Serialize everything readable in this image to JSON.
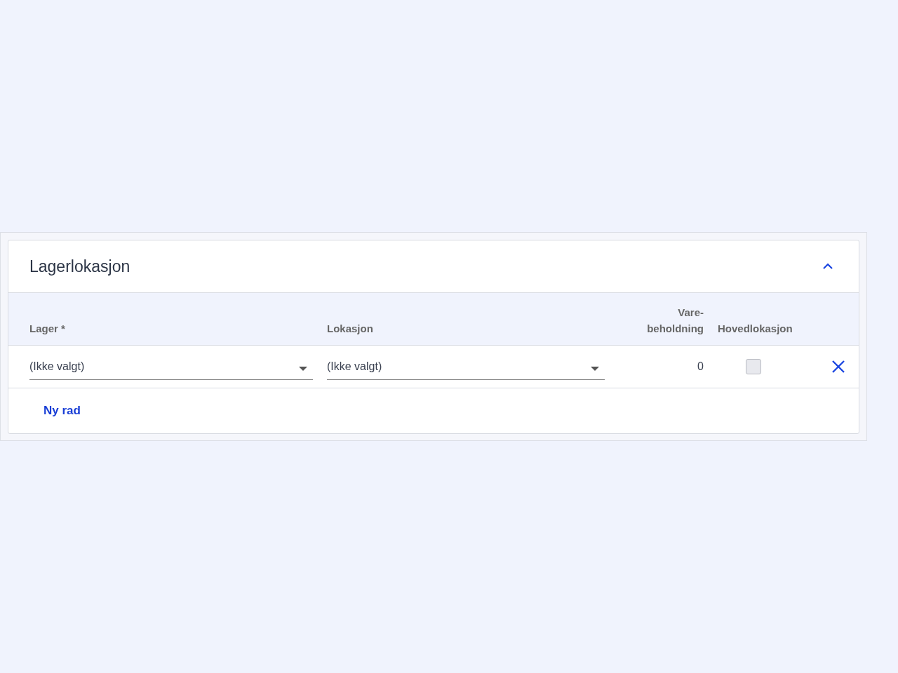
{
  "section": {
    "title": "Lagerlokasjon",
    "expanded": true
  },
  "columns": [
    "Lager *",
    "Lokasjon",
    "Vare-beholdning",
    "Hovedlokasjon"
  ],
  "rows": [
    {
      "lager": "(Ikke valgt)",
      "lokasjon": "(Ikke valgt)",
      "stock": "0",
      "main_location": false
    }
  ],
  "add_row_label": "Ny rad"
}
